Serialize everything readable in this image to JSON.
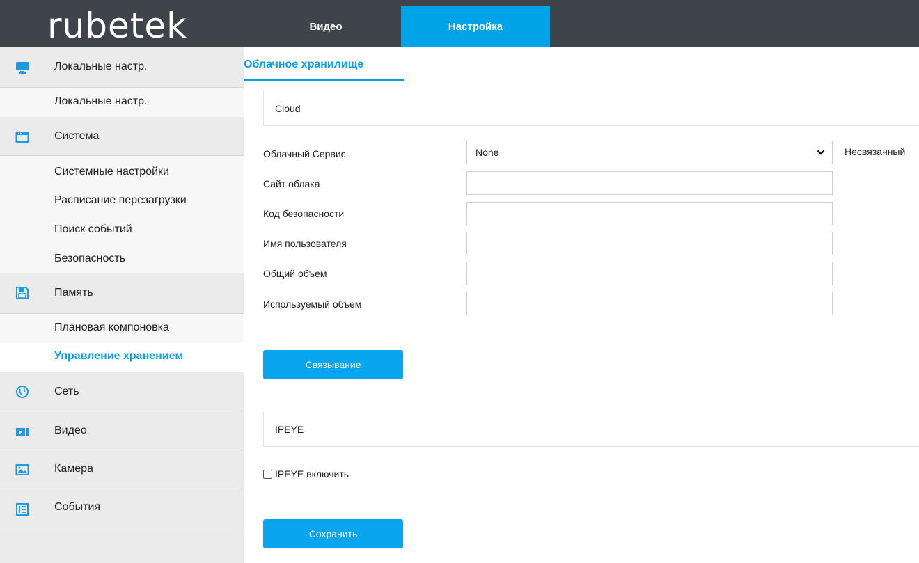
{
  "header": {
    "logo_text": "rubetek",
    "tabs": [
      {
        "label": "Видео",
        "active": false
      },
      {
        "label": "Настройка",
        "active": true
      }
    ],
    "accent_color": "#00a3e8"
  },
  "sidebar": {
    "items": [
      {
        "type": "group",
        "label": "Локальные настр.",
        "icon": "monitor-icon"
      },
      {
        "type": "sub",
        "label": "Локальные настр."
      },
      {
        "type": "group",
        "label": "Система",
        "icon": "system-window-icon"
      },
      {
        "type": "sub",
        "label": "Системные настройки"
      },
      {
        "type": "sub",
        "label": "Расписание перезагрузки"
      },
      {
        "type": "sub",
        "label": "Поиск событий"
      },
      {
        "type": "sub",
        "label": "Безопасность"
      },
      {
        "type": "group",
        "label": "Память",
        "icon": "floppy-disk-icon"
      },
      {
        "type": "sub",
        "label": "Плановая компоновка"
      },
      {
        "type": "sub",
        "label": "Управление хранением",
        "active": true
      },
      {
        "type": "group",
        "label": "Сеть",
        "icon": "globe-icon"
      },
      {
        "type": "group",
        "label": "Видео",
        "icon": "video-icon"
      },
      {
        "type": "group",
        "label": "Камера",
        "icon": "image-icon"
      },
      {
        "type": "group",
        "label": "События",
        "icon": "events-icon"
      }
    ]
  },
  "main": {
    "tab_label": "Облачное хранилище",
    "cloud_section_title": "Cloud",
    "form": {
      "cloud_service_label": "Облачный Сервис",
      "cloud_service_value": "None",
      "status_text": "Несвязанный",
      "cloud_site_label": "Сайт облака",
      "security_code_label": "Код безопасности",
      "username_label": "Имя пользователя",
      "total_volume_label": "Общий объем",
      "used_volume_label": "Используемый объем"
    },
    "bind_button": "Связывание",
    "ipeye_section_title": "IPEYE",
    "ipeye_enable_label": "IPEYE включить",
    "ipeye_enabled": false,
    "save_button": "Сохранить"
  }
}
